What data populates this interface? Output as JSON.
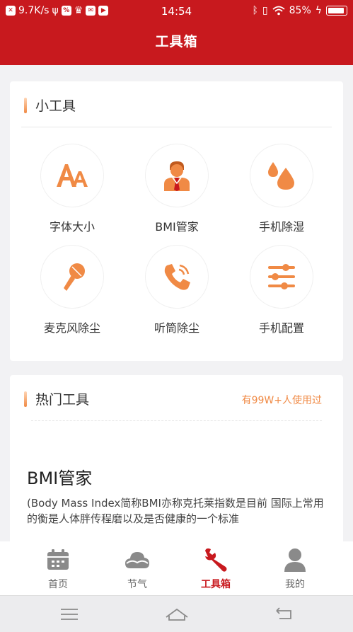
{
  "status_bar": {
    "speed": "9.7K/s",
    "time": "14:54",
    "battery": "85%"
  },
  "header": {
    "title": "工具箱"
  },
  "tools_section": {
    "title": "小工具",
    "items": [
      {
        "label": "字体大小",
        "icon": "font-size-icon"
      },
      {
        "label": "BMI管家",
        "icon": "person-icon"
      },
      {
        "label": "手机除湿",
        "icon": "water-drops-icon"
      },
      {
        "label": "麦克风除尘",
        "icon": "microphone-icon"
      },
      {
        "label": "听筒除尘",
        "icon": "phone-icon"
      },
      {
        "label": "手机配置",
        "icon": "sliders-icon"
      }
    ]
  },
  "hot_section": {
    "title": "热门工具",
    "subtitle": "有99W+人使用过",
    "item_title": "BMI管家",
    "item_desc": "(Body Mass Index简称BMI亦称克托莱指数是目前 国际上常用的衡是人体胖传程磨以及是否健康的一个标准"
  },
  "bottom_nav": {
    "items": [
      {
        "label": "首页",
        "icon": "calendar-icon"
      },
      {
        "label": "节气",
        "icon": "cloud-icon"
      },
      {
        "label": "工具箱",
        "icon": "wrench-icon"
      },
      {
        "label": "我的",
        "icon": "user-icon"
      }
    ],
    "active_index": 2
  },
  "colors": {
    "primary_red": "#c8191e",
    "accent_orange": "#f08a45",
    "icon_gray": "#8a8a8a"
  }
}
